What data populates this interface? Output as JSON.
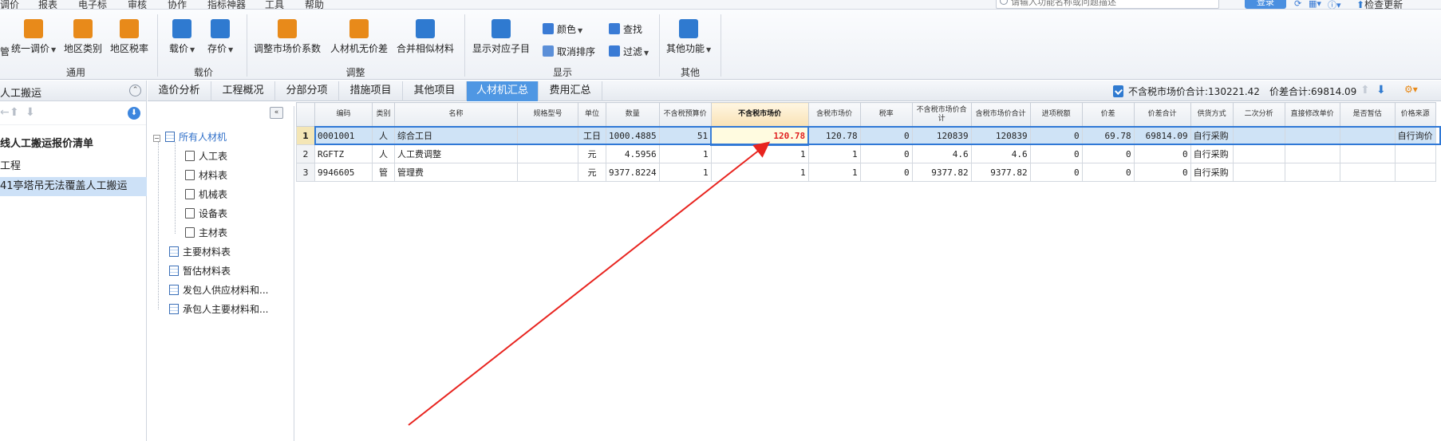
{
  "menu": [
    "调价",
    "报表",
    "电子标",
    "审核",
    "协作",
    "指标神器",
    "工具",
    "帮助"
  ],
  "search": {
    "placeholder": "请输入功能名称或问题描述"
  },
  "topbar": {
    "login_label": "登录",
    "check_update_label": "检查更新"
  },
  "ribbon": {
    "groups": [
      {
        "label": "通用",
        "buttons": [
          "统一调价",
          "地区类别",
          "地区税率"
        ]
      },
      {
        "label": "载价",
        "buttons": [
          "载价",
          "存价"
        ]
      },
      {
        "label": "调整",
        "buttons": [
          "调整市场价系数",
          "人材机无价差",
          "合并相似材料"
        ]
      },
      {
        "label": "显示",
        "buttons": [
          "显示对应子目"
        ],
        "small": [
          "颜色",
          "取消排序",
          "查找",
          "过滤"
        ]
      },
      {
        "label": "其他",
        "buttons": [
          "其他功能"
        ]
      }
    ]
  },
  "left_panel": {
    "title": "人工搬运",
    "items": [
      {
        "label": "线人工搬运报价清单"
      },
      {
        "label": "工程"
      },
      {
        "label": "41亭塔吊无法覆盖人工搬运"
      }
    ]
  },
  "tree": {
    "root": "所有人材机",
    "children": [
      "人工表",
      "材料表",
      "机械表",
      "设备表",
      "主材表"
    ],
    "others": [
      "主要材料表",
      "暂估材料表",
      "发包人供应材料和...",
      "承包人主要材料和..."
    ]
  },
  "tabs": [
    "造价分析",
    "工程概况",
    "分部分项",
    "措施项目",
    "其他项目",
    "人材机汇总",
    "费用汇总"
  ],
  "summary": {
    "market_total_label": "不含税市场价合计:",
    "market_total_value": "130221.42",
    "diff_total_label": "价差合计:",
    "diff_total_value": "69814.09"
  },
  "grid": {
    "headers": [
      "编码",
      "类别",
      "名称",
      "规格型号",
      "单位",
      "数量",
      "不含税预算价",
      "不含税市场价",
      "含税市场价",
      "税率",
      "不含税市场价合计",
      "含税市场价合计",
      "进项税额",
      "价差",
      "价差合计",
      "供货方式",
      "二次分析",
      "直接修改单价",
      "是否暂估",
      "价格来源"
    ],
    "rows": [
      [
        "1",
        "0001001",
        "人",
        "综合工日",
        "",
        "工日",
        "1000.4885",
        "51",
        "120.78",
        "120.78",
        "0",
        "120839",
        "120839",
        "0",
        "69.78",
        "69814.09",
        "自行采购",
        "",
        "",
        "",
        "自行询价"
      ],
      [
        "2",
        "RGFTZ",
        "人",
        "人工费调整",
        "",
        "元",
        "4.5956",
        "1",
        "1",
        "1",
        "0",
        "4.6",
        "4.6",
        "0",
        "0",
        "0",
        "自行采购",
        "",
        "",
        "",
        ""
      ],
      [
        "3",
        "9946605",
        "管",
        "管理费",
        "",
        "元",
        "9377.8224",
        "1",
        "1",
        "1",
        "0",
        "9377.82",
        "9377.82",
        "0",
        "0",
        "0",
        "自行采购",
        "",
        "",
        "",
        ""
      ]
    ]
  },
  "colors": {
    "accent": "#4f97e3",
    "selected_row": "#cfe3f6",
    "edited_value": "#e02020",
    "annotation_arrow": "#e8241f"
  }
}
